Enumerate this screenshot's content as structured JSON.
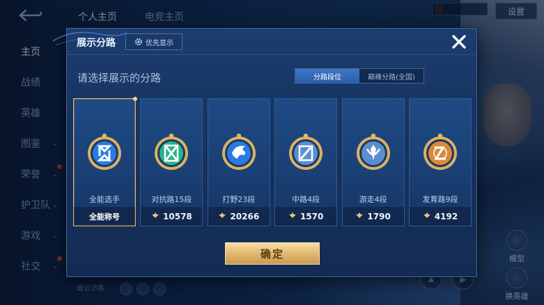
{
  "background": {
    "top_tabs": [
      "个人主页",
      "电竞主页"
    ],
    "settings_label": "设置",
    "sidebar_items": [
      {
        "label": "主页",
        "active": true,
        "chevron": false,
        "dot": false
      },
      {
        "label": "战绩",
        "active": false,
        "chevron": false,
        "dot": false
      },
      {
        "label": "英雄",
        "active": false,
        "chevron": false,
        "dot": false
      },
      {
        "label": "图鉴",
        "active": false,
        "chevron": true,
        "dot": false
      },
      {
        "label": "荣誉",
        "active": false,
        "chevron": true,
        "dot": true
      },
      {
        "label": "护卫队",
        "active": false,
        "chevron": true,
        "dot": false
      },
      {
        "label": "游戏",
        "active": false,
        "chevron": true,
        "dot": false
      },
      {
        "label": "社交",
        "active": false,
        "chevron": true,
        "dot": true
      }
    ],
    "visitor_label": "最近访客：",
    "right_buttons": [
      "模型",
      "换英雄"
    ]
  },
  "dialog": {
    "title": "展示分路",
    "priority_label": "优先显示",
    "subtitle": "请选择展示的分路",
    "segments": [
      {
        "label": "分路段位",
        "active": true
      },
      {
        "label": "巅峰分路(全国)",
        "active": false
      }
    ],
    "lanes": [
      {
        "name": "全能选手",
        "footer": "全能称号",
        "show_stat_icon": false,
        "selected": true,
        "badge": "allround",
        "accent": "#2a7be0"
      },
      {
        "name": "对抗路15段",
        "footer": "10578",
        "show_stat_icon": true,
        "selected": false,
        "badge": "clash",
        "accent": "#25b58a"
      },
      {
        "name": "打野23段",
        "footer": "20266",
        "show_stat_icon": true,
        "selected": false,
        "badge": "jungle",
        "accent": "#2a7be0"
      },
      {
        "name": "中路4段",
        "footer": "1570",
        "show_stat_icon": true,
        "selected": false,
        "badge": "mid",
        "accent": "#5a8ed0"
      },
      {
        "name": "游走4段",
        "footer": "1790",
        "show_stat_icon": true,
        "selected": false,
        "badge": "roam",
        "accent": "#5a8ed0"
      },
      {
        "name": "发育路9段",
        "footer": "4192",
        "show_stat_icon": true,
        "selected": false,
        "badge": "farm",
        "accent": "#d88a3a"
      }
    ],
    "confirm_label": "确定"
  },
  "colors": {
    "accent_gold": "#e2b970",
    "segment_active": "#2b5ea8",
    "dialog_bg": "#17335f"
  }
}
